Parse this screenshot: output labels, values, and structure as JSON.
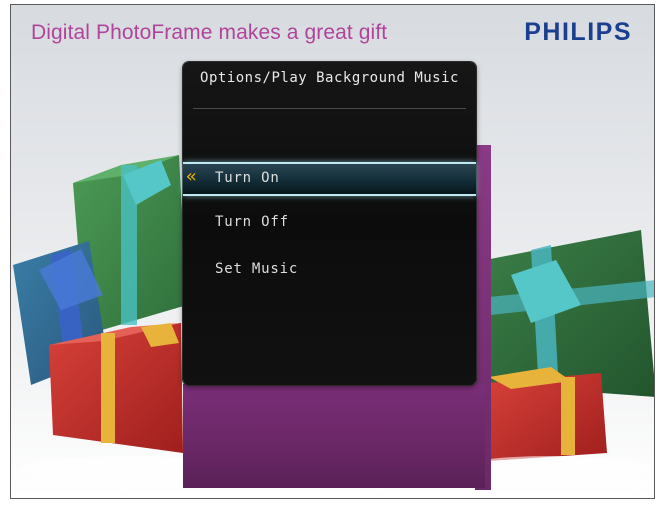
{
  "header": {
    "tagline": "Digital PhotoFrame makes a great gift",
    "brand": "PHILIPS"
  },
  "menu": {
    "title": "Options/Play Background Music",
    "items": [
      {
        "label": "Turn On",
        "selected": true
      },
      {
        "label": "Turn Off",
        "selected": false
      },
      {
        "label": "Set Music",
        "selected": false
      }
    ],
    "selection_indicator": "double-chevron-left-icon"
  },
  "colors": {
    "tagline": "#b0449a",
    "brand": "#1b3f8f",
    "menu_background": "#111111",
    "selection_glow": "#bfe9f3",
    "selection_arrow": "#f0b400",
    "stand": "#6a2766"
  }
}
